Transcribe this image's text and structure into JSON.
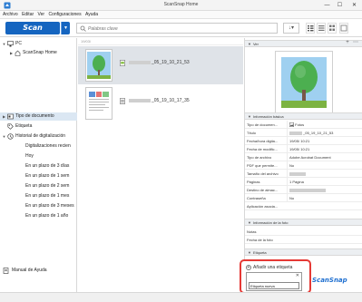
{
  "window": {
    "title": "ScanSnap Home",
    "minimize": "—",
    "maximize": "☐",
    "close": "✕"
  },
  "menu": [
    "Archivo",
    "Editar",
    "Ver",
    "Configuraciones",
    "Ayuda"
  ],
  "toolbar": {
    "scan_label": "Scan",
    "search_placeholder": "Palabras clave",
    "sort_icon": "↓▾"
  },
  "tree": {
    "pc": "PC",
    "scansnap_home": "ScanSnap Home",
    "doc_type": "Tipo de documento",
    "tag": "Etiqueta",
    "history": "Historial de digitalización",
    "history_items": [
      "Digitalizaciones recien",
      "Hoy",
      "En un plazo de 3 días",
      "En un plazo de 1 sem",
      "En un plazo de 2 sem",
      "En un plazo de 1 mes",
      "En un plazo de 3 meses",
      "En un plazo de 1 año"
    ],
    "manual": "Manual de Ayuda"
  },
  "list": {
    "header": "19/03/",
    "items": [
      {
        "name": "_05_19_10_21_53",
        "selected": true
      },
      {
        "name": "_05_19_10_17_35",
        "selected": false
      }
    ]
  },
  "preview": {
    "section_title": "Ver"
  },
  "info": {
    "section_title": "Información básica",
    "rows": [
      {
        "label": "Tipo de documen...",
        "value": "Fotos"
      },
      {
        "label": "Título",
        "value": "_05_19_10_21_53"
      },
      {
        "label": "Fecha/hora digita...",
        "value": "19/05/          10:21"
      },
      {
        "label": "Fecha de modific...",
        "value": "19/05/          10:21"
      },
      {
        "label": "Tipo de archivo",
        "value": "Adobe Acrobat Document"
      },
      {
        "label": "PDF que permite...",
        "value": "No"
      },
      {
        "label": "Tamaño del archivo",
        "value": ""
      },
      {
        "label": "Páginas",
        "value": "1 Página"
      },
      {
        "label": "Destino de almac...",
        "value": ""
      },
      {
        "label": "Contraseña",
        "value": "No"
      },
      {
        "label": "Aplicación asocia...",
        "value": ""
      }
    ]
  },
  "photo": {
    "section_title": "Información de la foto",
    "rows": [
      {
        "label": "Notas",
        "value": ""
      },
      {
        "label": "Fecha de la foto",
        "value": ""
      }
    ]
  },
  "tags": {
    "section_title": "Etiqueta",
    "add_label": "Añadir una etiqueta",
    "close": "✕",
    "input_value": "Etiqueta nueva"
  },
  "brand": "ScanSnap",
  "colors": {
    "accent": "#1565c0",
    "highlight": "#e53935",
    "selection": "#dbe7f3"
  }
}
